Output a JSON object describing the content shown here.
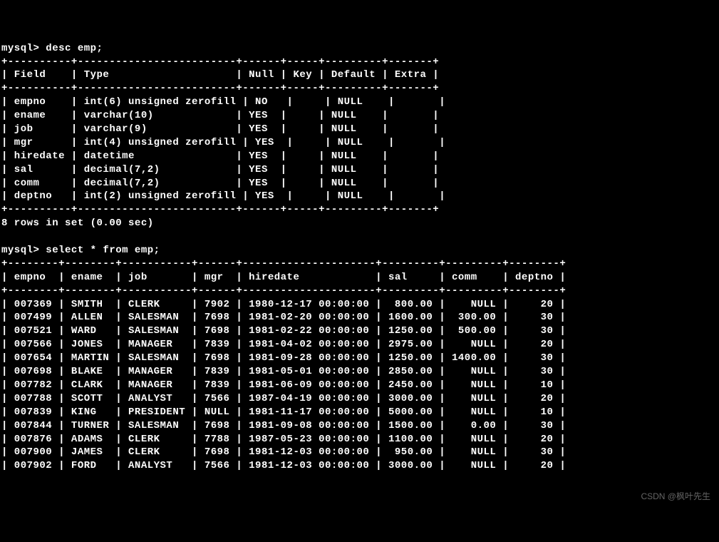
{
  "prompt1": "mysql> desc emp;",
  "desc_border": "+----------+-------------------------+------+-----+---------+-------+",
  "desc_header": "| Field    | Type                    | Null | Key | Default | Extra |",
  "desc_rows": [
    "| empno    | int(6) unsigned zerofill | NO   |     | NULL    |       |",
    "| ename    | varchar(10)             | YES  |     | NULL    |       |",
    "| job      | varchar(9)              | YES  |     | NULL    |       |",
    "| mgr      | int(4) unsigned zerofill | YES  |     | NULL    |       |",
    "| hiredate | datetime                | YES  |     | NULL    |       |",
    "| sal      | decimal(7,2)            | YES  |     | NULL    |       |",
    "| comm     | decimal(7,2)            | YES  |     | NULL    |       |",
    "| deptno   | int(2) unsigned zerofill | YES  |     | NULL    |       |"
  ],
  "desc_footer": "8 rows in set (0.00 sec)",
  "prompt2": "mysql> select * from emp;",
  "sel_border": "+--------+--------+-----------+------+---------------------+---------+---------+--------+",
  "sel_header": "| empno  | ename  | job       | mgr  | hiredate            | sal     | comm    | deptno |",
  "sel_rows": [
    "| 007369 | SMITH  | CLERK     | 7902 | 1980-12-17 00:00:00 |  800.00 |    NULL |     20 |",
    "| 007499 | ALLEN  | SALESMAN  | 7698 | 1981-02-20 00:00:00 | 1600.00 |  300.00 |     30 |",
    "| 007521 | WARD   | SALESMAN  | 7698 | 1981-02-22 00:00:00 | 1250.00 |  500.00 |     30 |",
    "| 007566 | JONES  | MANAGER   | 7839 | 1981-04-02 00:00:00 | 2975.00 |    NULL |     20 |",
    "| 007654 | MARTIN | SALESMAN  | 7698 | 1981-09-28 00:00:00 | 1250.00 | 1400.00 |     30 |",
    "| 007698 | BLAKE  | MANAGER   | 7839 | 1981-05-01 00:00:00 | 2850.00 |    NULL |     30 |",
    "| 007782 | CLARK  | MANAGER   | 7839 | 1981-06-09 00:00:00 | 2450.00 |    NULL |     10 |",
    "| 007788 | SCOTT  | ANALYST   | 7566 | 1987-04-19 00:00:00 | 3000.00 |    NULL |     20 |",
    "| 007839 | KING   | PRESIDENT | NULL | 1981-11-17 00:00:00 | 5000.00 |    NULL |     10 |",
    "| 007844 | TURNER | SALESMAN  | 7698 | 1981-09-08 00:00:00 | 1500.00 |    0.00 |     30 |",
    "| 007876 | ADAMS  | CLERK     | 7788 | 1987-05-23 00:00:00 | 1100.00 |    NULL |     20 |",
    "| 007900 | JAMES  | CLERK     | 7698 | 1981-12-03 00:00:00 |  950.00 |    NULL |     30 |",
    "| 007902 | FORD   | ANALYST   | 7566 | 1981-12-03 00:00:00 | 3000.00 |    NULL |     20 |"
  ],
  "watermark": "CSDN @枫叶先生",
  "chart_data": {
    "type": "table",
    "desc_table": {
      "columns": [
        "Field",
        "Type",
        "Null",
        "Key",
        "Default",
        "Extra"
      ],
      "rows": [
        [
          "empno",
          "int(6) unsigned zerofill",
          "NO",
          "",
          "NULL",
          ""
        ],
        [
          "ename",
          "varchar(10)",
          "YES",
          "",
          "NULL",
          ""
        ],
        [
          "job",
          "varchar(9)",
          "YES",
          "",
          "NULL",
          ""
        ],
        [
          "mgr",
          "int(4) unsigned zerofill",
          "YES",
          "",
          "NULL",
          ""
        ],
        [
          "hiredate",
          "datetime",
          "YES",
          "",
          "NULL",
          ""
        ],
        [
          "sal",
          "decimal(7,2)",
          "YES",
          "",
          "NULL",
          ""
        ],
        [
          "comm",
          "decimal(7,2)",
          "YES",
          "",
          "NULL",
          ""
        ],
        [
          "deptno",
          "int(2) unsigned zerofill",
          "YES",
          "",
          "NULL",
          ""
        ]
      ]
    },
    "select_table": {
      "columns": [
        "empno",
        "ename",
        "job",
        "mgr",
        "hiredate",
        "sal",
        "comm",
        "deptno"
      ],
      "rows": [
        [
          "007369",
          "SMITH",
          "CLERK",
          "7902",
          "1980-12-17 00:00:00",
          "800.00",
          "NULL",
          "20"
        ],
        [
          "007499",
          "ALLEN",
          "SALESMAN",
          "7698",
          "1981-02-20 00:00:00",
          "1600.00",
          "300.00",
          "30"
        ],
        [
          "007521",
          "WARD",
          "SALESMAN",
          "7698",
          "1981-02-22 00:00:00",
          "1250.00",
          "500.00",
          "30"
        ],
        [
          "007566",
          "JONES",
          "MANAGER",
          "7839",
          "1981-04-02 00:00:00",
          "2975.00",
          "NULL",
          "20"
        ],
        [
          "007654",
          "MARTIN",
          "SALESMAN",
          "7698",
          "1981-09-28 00:00:00",
          "1250.00",
          "1400.00",
          "30"
        ],
        [
          "007698",
          "BLAKE",
          "MANAGER",
          "7839",
          "1981-05-01 00:00:00",
          "2850.00",
          "NULL",
          "30"
        ],
        [
          "007782",
          "CLARK",
          "MANAGER",
          "7839",
          "1981-06-09 00:00:00",
          "2450.00",
          "NULL",
          "10"
        ],
        [
          "007788",
          "SCOTT",
          "ANALYST",
          "7566",
          "1987-04-19 00:00:00",
          "3000.00",
          "NULL",
          "20"
        ],
        [
          "007839",
          "KING",
          "PRESIDENT",
          "NULL",
          "1981-11-17 00:00:00",
          "5000.00",
          "NULL",
          "10"
        ],
        [
          "007844",
          "TURNER",
          "SALESMAN",
          "7698",
          "1981-09-08 00:00:00",
          "1500.00",
          "0.00",
          "30"
        ],
        [
          "007876",
          "ADAMS",
          "CLERK",
          "7788",
          "1987-05-23 00:00:00",
          "1100.00",
          "NULL",
          "20"
        ],
        [
          "007900",
          "JAMES",
          "CLERK",
          "7698",
          "1981-12-03 00:00:00",
          "950.00",
          "NULL",
          "30"
        ],
        [
          "007902",
          "FORD",
          "ANALYST",
          "7566",
          "1981-12-03 00:00:00",
          "3000.00",
          "NULL",
          "20"
        ]
      ]
    }
  }
}
